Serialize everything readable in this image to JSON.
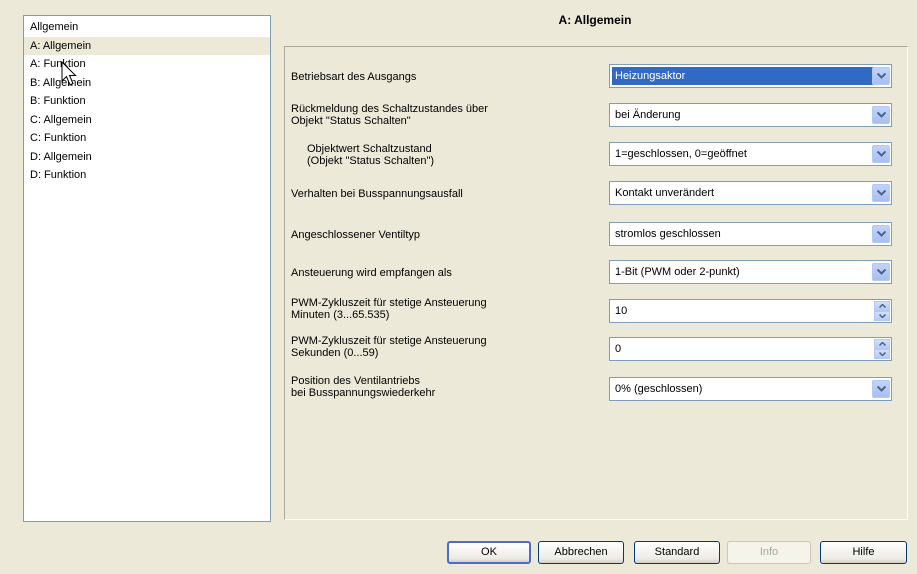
{
  "tree": {
    "items": [
      {
        "label": "Allgemein",
        "selected": false
      },
      {
        "label": "A: Allgemein",
        "selected": true
      },
      {
        "label": "A: Funktion",
        "selected": false
      },
      {
        "label": "B: Allgemein",
        "selected": false
      },
      {
        "label": "B: Funktion",
        "selected": false
      },
      {
        "label": "C: Allgemein",
        "selected": false
      },
      {
        "label": "C: Funktion",
        "selected": false
      },
      {
        "label": "D: Allgemein",
        "selected": false
      },
      {
        "label": "D: Funktion",
        "selected": false
      }
    ]
  },
  "page": {
    "title": "A: Allgemein"
  },
  "params": [
    {
      "label": [
        "Betriebsart des Ausgangs"
      ],
      "value": "Heizungsaktor",
      "type": "dropdown",
      "highlight": true
    },
    {
      "label": [
        "Rückmeldung des Schaltzustandes über",
        "Objekt \"Status Schalten\""
      ],
      "value": "bei Änderung",
      "type": "dropdown"
    },
    {
      "label": [
        "Objektwert Schaltzustand",
        "(Objekt \"Status Schalten\")"
      ],
      "value": "1=geschlossen, 0=geöffnet",
      "type": "dropdown",
      "indent": true
    },
    {
      "label": [
        "Verhalten bei Busspannungsausfall"
      ],
      "value": "Kontakt unverändert",
      "type": "dropdown"
    },
    {
      "label": [
        "Angeschlossener Ventiltyp"
      ],
      "value": "stromlos geschlossen",
      "type": "dropdown"
    },
    {
      "label": [
        "Ansteuerung wird empfangen als"
      ],
      "value": "1-Bit (PWM oder 2-punkt)",
      "type": "dropdown"
    },
    {
      "label": [
        "PWM-Zykluszeit für stetige Ansteuerung",
        "Minuten (3...65.535)"
      ],
      "value": "10",
      "type": "spin"
    },
    {
      "label": [
        "PWM-Zykluszeit für stetige Ansteuerung",
        "Sekunden (0...59)"
      ],
      "value": "0",
      "type": "spin"
    },
    {
      "label": [
        "Position des Ventilantriebs",
        "bei Busspannungswiederkehr"
      ],
      "value": "0% (geschlossen)",
      "type": "dropdown"
    }
  ],
  "buttons": {
    "ok": "OK",
    "cancel": "Abbrechen",
    "standard": "Standard",
    "info": "Info",
    "help": "Hilfe"
  },
  "colors": {
    "highlight": "#316ac5",
    "background": "#ece9d8",
    "border": "#7f9db9"
  }
}
